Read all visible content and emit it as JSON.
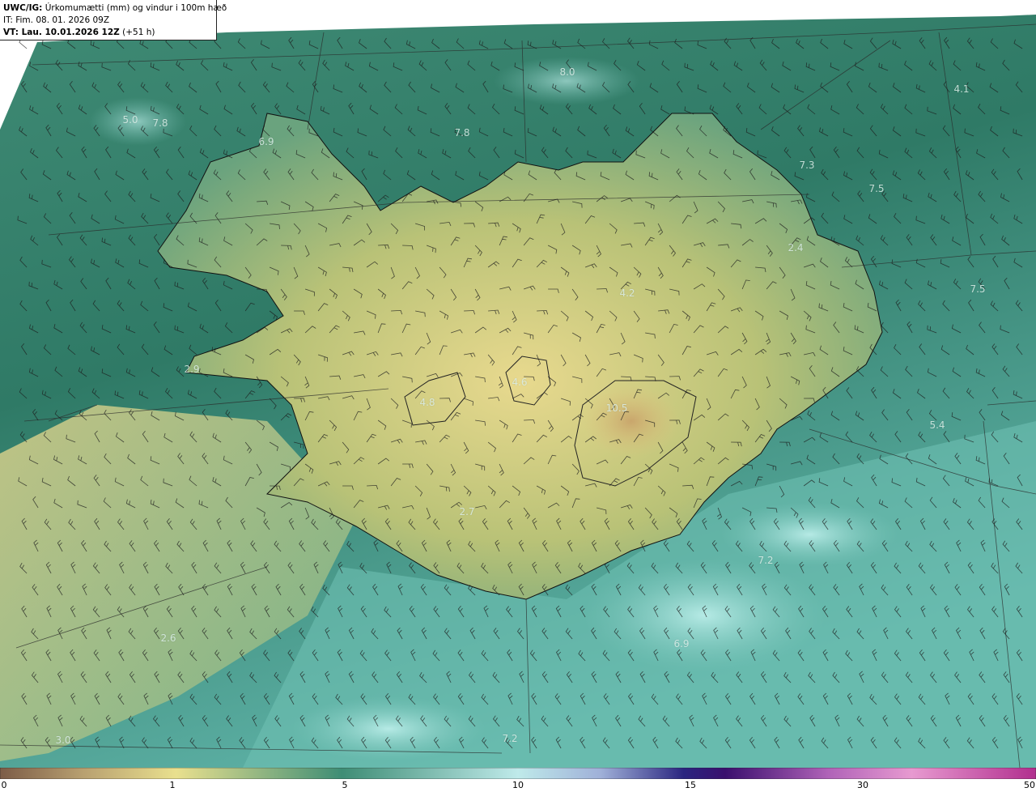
{
  "header": {
    "model_label": "UWC/IG:",
    "title_text": "Úrkomumætti (mm) og vindur i 100m hæð",
    "it_text": "IT: Fim. 08. 01. 2026 09Z",
    "vt_label": "VT: Lau. 10.01.2026 12Z",
    "vt_offset": "(+51 h)"
  },
  "value_labels": [
    "5.0",
    "7.8",
    "6.9",
    "8.0",
    "7.8",
    "4.1",
    "7.3",
    "7.5",
    "2.4",
    "4.2",
    "7.5",
    "2.9",
    "4.6",
    "4.8",
    "10.5",
    "5.4",
    "2.6",
    "3.0",
    "7.2",
    "2.7",
    "6.9",
    "7.2"
  ],
  "colorbar": {
    "ticks": [
      "0",
      "1",
      "5",
      "10",
      "15",
      "30",
      "50"
    ],
    "colors": [
      "#7c5c47",
      "#b8a070",
      "#e9e08e",
      "#3e8d75",
      "#bfeaea",
      "#9fb0d8",
      "#2a2580",
      "#3a0f6e",
      "#b063b8",
      "#e79ad0",
      "#b12e8e"
    ]
  }
}
